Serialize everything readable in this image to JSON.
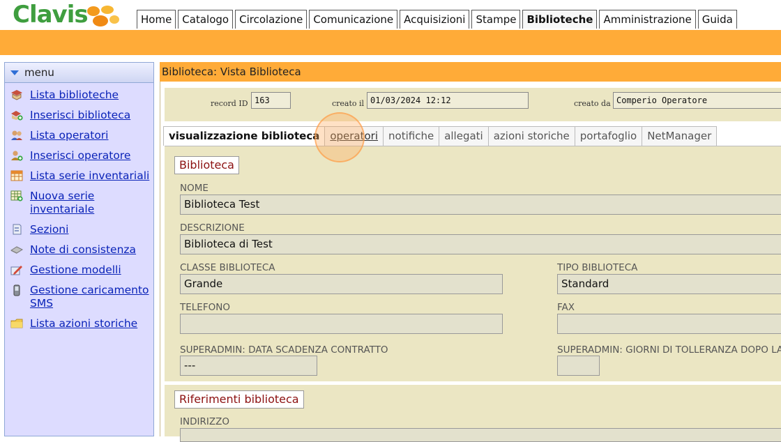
{
  "app": {
    "logo_text": "Clavis"
  },
  "nav": {
    "tabs": [
      {
        "label": "Home"
      },
      {
        "label": "Catalogo"
      },
      {
        "label": "Circolazione"
      },
      {
        "label": "Comunicazione"
      },
      {
        "label": "Acquisizioni"
      },
      {
        "label": "Stampe"
      },
      {
        "label": "Biblioteche",
        "active": true
      },
      {
        "label": "Amministrazione"
      },
      {
        "label": "Guida"
      }
    ]
  },
  "sidebar": {
    "title": "menu",
    "items": [
      {
        "label": "Lista biblioteche",
        "icon": "library-icon"
      },
      {
        "label": "Inserisci biblioteca",
        "icon": "add-library-icon"
      },
      {
        "label": "Lista operatori",
        "icon": "users-icon"
      },
      {
        "label": "Inserisci operatore",
        "icon": "add-user-icon"
      },
      {
        "label": "Lista serie inventariali",
        "icon": "grid-icon"
      },
      {
        "label": "Nuova serie inventariale",
        "icon": "add-grid-icon"
      },
      {
        "label": "Sezioni",
        "icon": "section-icon"
      },
      {
        "label": "Note di consistenza",
        "icon": "eraser-icon"
      },
      {
        "label": "Gestione modelli",
        "icon": "edit-icon"
      },
      {
        "label": "Gestione caricamento SMS",
        "icon": "phone-icon"
      },
      {
        "label": "Lista azioni storiche",
        "icon": "folder-icon"
      }
    ]
  },
  "page": {
    "title": "Biblioteca: Vista Biblioteca"
  },
  "record": {
    "id_label": "record ID",
    "id_value": "163",
    "created_label": "creato il",
    "created_value": "01/03/2024 12:12",
    "created_by_label": "creato da",
    "created_by_value": "Comperio Operatore"
  },
  "tabs": [
    {
      "label": "visualizzazione biblioteca",
      "active": true
    },
    {
      "label": "operatori"
    },
    {
      "label": "notifiche"
    },
    {
      "label": "allegati"
    },
    {
      "label": "azioni storiche"
    },
    {
      "label": "portafoglio"
    },
    {
      "label": "NetManager"
    }
  ],
  "library": {
    "legend": "Biblioteca",
    "name_label": "NOME",
    "name_value": "Biblioteca Test",
    "desc_label": "DESCRIZIONE",
    "desc_value": "Biblioteca di Test",
    "class_label": "CLASSE BIBLIOTECA",
    "class_value": "Grande",
    "type_label": "TIPO BIBLIOTECA",
    "type_value": "Standard",
    "phone_label": "TELEFONO",
    "phone_value": "",
    "fax_label": "FAX",
    "fax_value": "",
    "contract_label": "SUPERADMIN: DATA SCADENZA CONTRATTO",
    "contract_value": "---",
    "tolerance_label": "SUPERADMIN: GIORNI DI TOLLERANZA DOPO LA SC",
    "tolerance_value": ""
  },
  "references": {
    "legend": "Riferimenti biblioteca",
    "address_label": "INDIRIZZO",
    "address_value": ""
  }
}
